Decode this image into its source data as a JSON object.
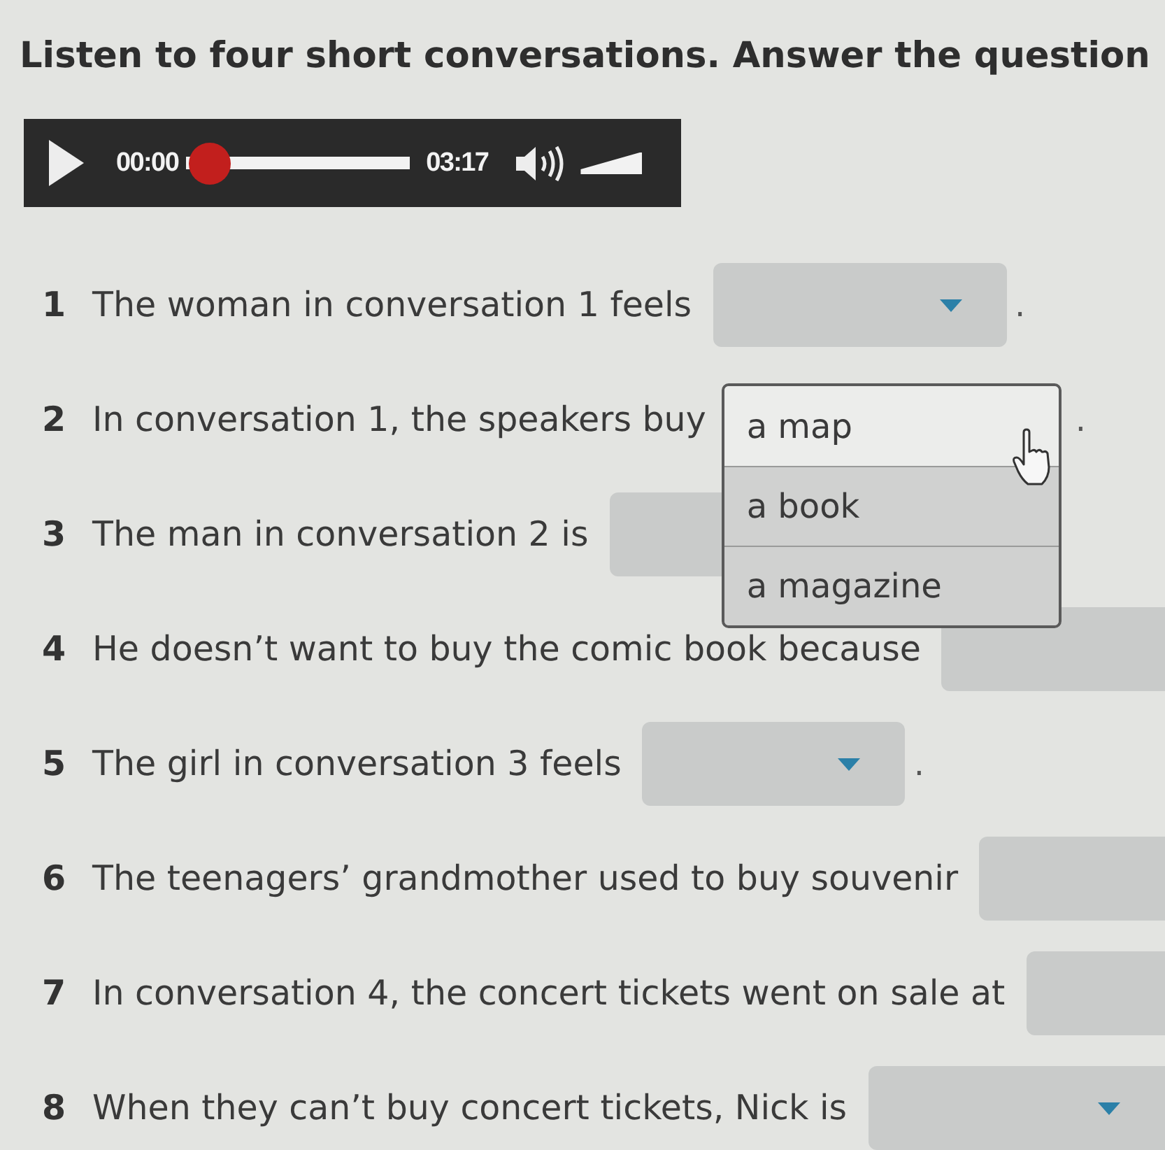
{
  "instruction": "Listen to four short conversations. Answer the question",
  "player": {
    "elapsed": "00:00",
    "progress": {
      "level": 0
    },
    "duration": "03:17",
    "volume": {
      "level": 1
    }
  },
  "questions": [
    {
      "number": "1",
      "text": "The woman in conversation 1 feels",
      "answer": {
        "kind": "select",
        "arrow": true
      },
      "end": "."
    },
    {
      "number": "2",
      "text": "In conversation 1, the speakers buy",
      "answer": {
        "kind": "open-list",
        "options": [
          {
            "label": "a map",
            "selected": true
          },
          {
            "label": "a book",
            "selected": false
          },
          {
            "label": "a magazine",
            "selected": false
          }
        ]
      },
      "end": "."
    },
    {
      "number": "3",
      "text": "The man in conversation 2 is",
      "answer": {
        "kind": "select",
        "arrow": false
      }
    },
    {
      "number": "4",
      "text": "He doesn’t want to buy the comic book because",
      "answer": {
        "kind": "select",
        "arrow": false
      }
    },
    {
      "number": "5",
      "text": "The girl in conversation 3 feels",
      "answer": {
        "kind": "select",
        "arrow": true
      },
      "end": "."
    },
    {
      "number": "6",
      "text": "The teenagers’ grandmother used to buy souvenir",
      "answer": {
        "kind": "select",
        "arrow": false
      }
    },
    {
      "number": "7",
      "text": "In conversation 4, the concert tickets went on sale at",
      "answer": {
        "kind": "select",
        "arrow": false
      }
    },
    {
      "number": "8",
      "text": "When they can’t buy concert tickets, Nick is",
      "answer": {
        "kind": "select",
        "arrow": true
      }
    }
  ]
}
